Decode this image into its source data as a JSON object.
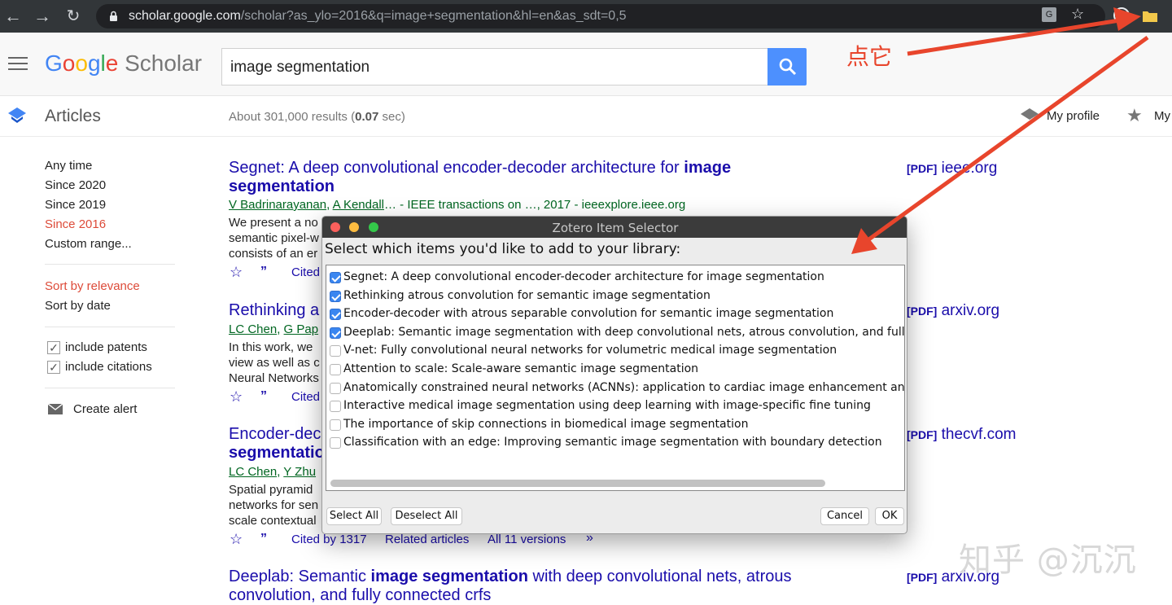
{
  "browser": {
    "url_host": "scholar.google.com",
    "url_path": "/scholar?as_ylo=2016&q=image+segmentation&hl=en&as_sdt=0,5"
  },
  "header": {
    "logo_google": "Google",
    "logo_scholar": "Scholar",
    "search_query": "image segmentation",
    "articles_label": "Articles",
    "results_prefix": "About 301,000 results (",
    "results_time": "0.07",
    "results_suffix": " sec)",
    "my_profile": "My profile",
    "my_library": "My"
  },
  "sidebar": {
    "time_filters": [
      "Any time",
      "Since 2020",
      "Since 2019",
      "Since 2016",
      "Custom range..."
    ],
    "sort_relevance": "Sort by relevance",
    "sort_date": "Sort by date",
    "include_patents": "include patents",
    "include_citations": "include citations",
    "create_alert": "Create alert"
  },
  "results": [
    {
      "title_a": "Segnet: A deep convolutional encoder-decoder architecture for ",
      "title_b": "image",
      "title_c": "segmentation",
      "author1": "V Badrinarayanan",
      "author2": "A Kendall",
      "source": "… - IEEE transactions on …, 2017 - ieeexplore.ieee.org",
      "snippet1": "We present a no",
      "snippet2": "semantic pixel-w",
      "snippet3": "consists of an er",
      "cited": "Cited",
      "pdf_tag": "[PDF]",
      "pdf_host": "ieee.org"
    },
    {
      "title_a": "Rethinking a",
      "author1": "LC Chen",
      "author2": "G Pap",
      "snippet1": "In this work, we",
      "snippet2": "view as well as c",
      "snippet3": "Neural Networks",
      "cited": "Cited",
      "pdf_tag": "[PDF]",
      "pdf_host": "arxiv.org"
    },
    {
      "title_a": "Encoder-dec",
      "title_c": "segmentatio",
      "author1": "LC Chen",
      "author2": "Y Zhu",
      "snippet1": "Spatial pyramid",
      "snippet2": "networks for sen",
      "snippet3": "scale contextual",
      "cited": "Cited by 1317",
      "related": "Related articles",
      "versions": "All 11 versions",
      "pdf_tag": "[PDF]",
      "pdf_host": "thecvf.com"
    },
    {
      "title_a": "Deeplab: Semantic ",
      "title_b": "image segmentation",
      "title_c": " with deep convolutional nets, atrous",
      "title_d": "convolution, and fully connected crfs",
      "pdf_tag": "[PDF]",
      "pdf_host": "arxiv.org"
    }
  ],
  "dialog": {
    "title": "Zotero Item Selector",
    "prompt": "Select which items you'd like to add to your library:",
    "items": [
      {
        "label": "Segnet: A deep convolutional encoder-decoder architecture for image segmentation",
        "checked": true
      },
      {
        "label": "Rethinking atrous convolution for semantic image segmentation",
        "checked": true
      },
      {
        "label": "Encoder-decoder with atrous separable convolution for semantic image segmentation",
        "checked": true
      },
      {
        "label": "Deeplab: Semantic image segmentation with deep convolutional nets, atrous convolution, and fully",
        "checked": true
      },
      {
        "label": "V-net: Fully convolutional neural networks for volumetric medical image segmentation",
        "checked": false
      },
      {
        "label": "Attention to scale: Scale-aware semantic image segmentation",
        "checked": false
      },
      {
        "label": "Anatomically constrained neural networks (ACNNs): application to cardiac image enhancement and",
        "checked": false
      },
      {
        "label": "Interactive medical image segmentation using deep learning with image-specific fine tuning",
        "checked": false
      },
      {
        "label": "The importance of skip connections in biomedical image segmentation",
        "checked": false
      },
      {
        "label": "Classification with an edge: Improving semantic image segmentation with boundary detection",
        "checked": false
      }
    ],
    "select_all": "Select All",
    "deselect_all": "Deselect All",
    "cancel": "Cancel",
    "ok": "OK"
  },
  "annotation": "点它",
  "watermark": "知乎 @沉沉",
  "colors": {
    "accent": "#4d90fe",
    "annotation": "#e8452c",
    "link": "#1a0dab",
    "active_filter": "#dd4b39"
  }
}
